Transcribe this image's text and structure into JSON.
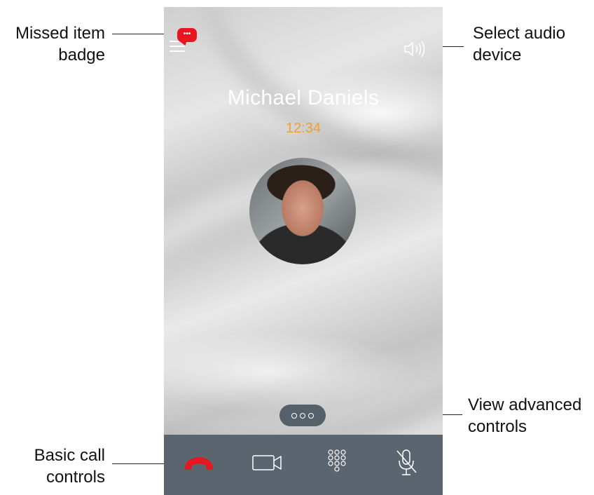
{
  "callouts": {
    "missed_badge": "Missed item\nbadge",
    "missed_badge_line1": "Missed item",
    "missed_badge_line2": "badge",
    "audio_line1": "Select audio",
    "audio_line2": "device",
    "advanced_line1": "View advanced",
    "advanced_line2": "controls",
    "basic_line1": "Basic call",
    "basic_line2": "controls"
  },
  "call": {
    "caller_name": "Michael Daniels",
    "duration": "12:34",
    "badge_text": "•••"
  },
  "icons": {
    "menu": "hamburger-menu-icon",
    "badge": "chat-bubble-icon",
    "audio": "speaker-icon",
    "more": "more-horizontal-icon",
    "end_call": "end-call-icon",
    "video": "video-camera-icon",
    "dialpad": "dialpad-icon",
    "mute": "microphone-muted-icon"
  },
  "colors": {
    "timer": "#f0a030",
    "badge": "#e8161f",
    "end_call": "#e8161f",
    "control_bar": "#5a6570",
    "more_button": "#56606a"
  }
}
